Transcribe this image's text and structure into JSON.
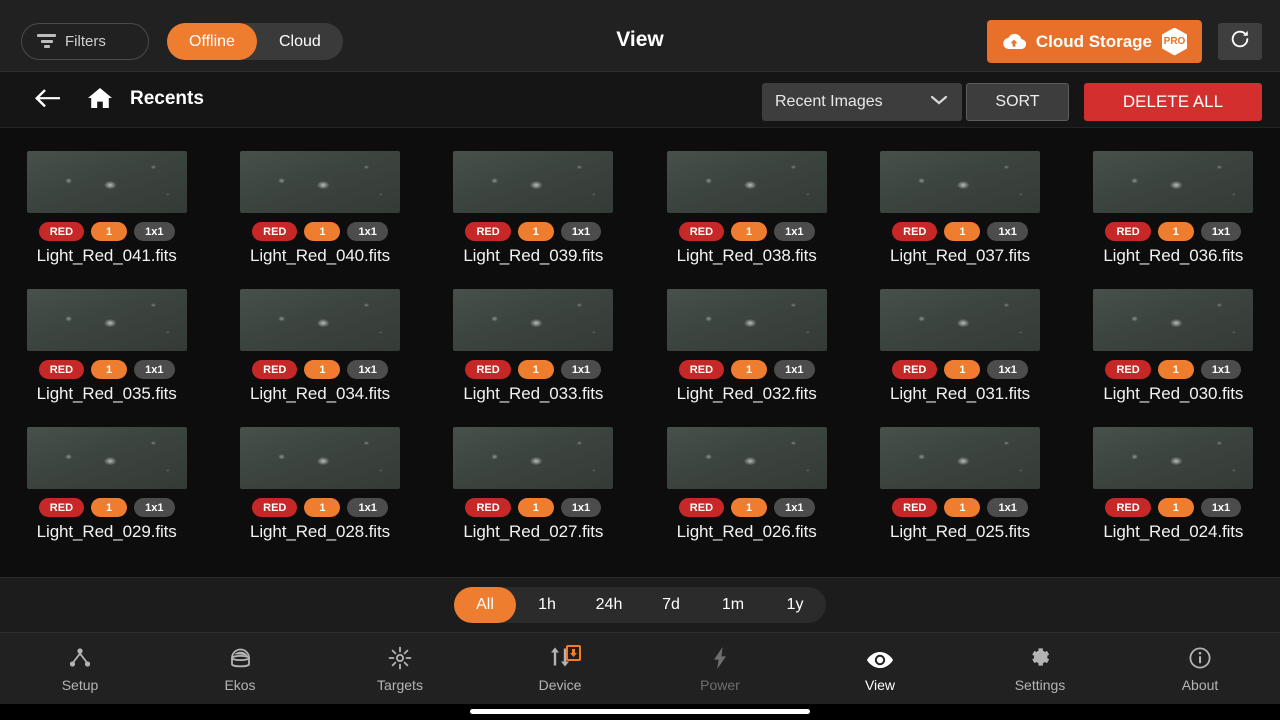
{
  "topbar": {
    "filters_label": "Filters",
    "filters_icon": "funnel-icon",
    "segment": {
      "offline_label": "Offline",
      "cloud_label": "Cloud",
      "active": "Offline"
    },
    "title": "View",
    "cloud_storage_label": "Cloud Storage",
    "cloud_storage_icon": "cloud-upload-icon",
    "pro_badge": "PRO",
    "refresh_icon": "refresh-icon",
    "accent_color": "#ef7d30",
    "cloud_button_color": "#e8702a"
  },
  "subbar": {
    "back_icon": "arrow-left-icon",
    "home_icon": "home-icon",
    "breadcrumb": "Recents",
    "dropdown_value": "Recent Images",
    "dropdown_icon": "chevron-down-icon",
    "sort_label": "SORT",
    "delete_all_label": "DELETE ALL",
    "delete_color": "#d32f2f"
  },
  "gallery": {
    "items": [
      {
        "filename": "Light_Red_041.fits",
        "filter": "RED",
        "count": "1",
        "binning": "1x1"
      },
      {
        "filename": "Light_Red_040.fits",
        "filter": "RED",
        "count": "1",
        "binning": "1x1"
      },
      {
        "filename": "Light_Red_039.fits",
        "filter": "RED",
        "count": "1",
        "binning": "1x1"
      },
      {
        "filename": "Light_Red_038.fits",
        "filter": "RED",
        "count": "1",
        "binning": "1x1"
      },
      {
        "filename": "Light_Red_037.fits",
        "filter": "RED",
        "count": "1",
        "binning": "1x1"
      },
      {
        "filename": "Light_Red_036.fits",
        "filter": "RED",
        "count": "1",
        "binning": "1x1"
      },
      {
        "filename": "Light_Red_035.fits",
        "filter": "RED",
        "count": "1",
        "binning": "1x1"
      },
      {
        "filename": "Light_Red_034.fits",
        "filter": "RED",
        "count": "1",
        "binning": "1x1"
      },
      {
        "filename": "Light_Red_033.fits",
        "filter": "RED",
        "count": "1",
        "binning": "1x1"
      },
      {
        "filename": "Light_Red_032.fits",
        "filter": "RED",
        "count": "1",
        "binning": "1x1"
      },
      {
        "filename": "Light_Red_031.fits",
        "filter": "RED",
        "count": "1",
        "binning": "1x1"
      },
      {
        "filename": "Light_Red_030.fits",
        "filter": "RED",
        "count": "1",
        "binning": "1x1"
      },
      {
        "filename": "Light_Red_029.fits",
        "filter": "RED",
        "count": "1",
        "binning": "1x1"
      },
      {
        "filename": "Light_Red_028.fits",
        "filter": "RED",
        "count": "1",
        "binning": "1x1"
      },
      {
        "filename": "Light_Red_027.fits",
        "filter": "RED",
        "count": "1",
        "binning": "1x1"
      },
      {
        "filename": "Light_Red_026.fits",
        "filter": "RED",
        "count": "1",
        "binning": "1x1"
      },
      {
        "filename": "Light_Red_025.fits",
        "filter": "RED",
        "count": "1",
        "binning": "1x1"
      },
      {
        "filename": "Light_Red_024.fits",
        "filter": "RED",
        "count": "1",
        "binning": "1x1"
      }
    ]
  },
  "time_filter": {
    "options": [
      "All",
      "1h",
      "24h",
      "7d",
      "1m",
      "1y"
    ],
    "active": "All"
  },
  "bottom_nav": {
    "items": [
      {
        "label": "Setup",
        "icon": "hierarchy-icon",
        "state": "normal"
      },
      {
        "label": "Ekos",
        "icon": "observatory-icon",
        "state": "normal"
      },
      {
        "label": "Targets",
        "icon": "star-burst-icon",
        "state": "normal"
      },
      {
        "label": "Device",
        "icon": "transfer-icon",
        "state": "normal",
        "badge": "download-badge"
      },
      {
        "label": "Power",
        "icon": "bolt-icon",
        "state": "dim"
      },
      {
        "label": "View",
        "icon": "eye-icon",
        "state": "active"
      },
      {
        "label": "Settings",
        "icon": "gear-icon",
        "state": "normal"
      },
      {
        "label": "About",
        "icon": "info-circle-icon",
        "state": "normal"
      }
    ]
  }
}
